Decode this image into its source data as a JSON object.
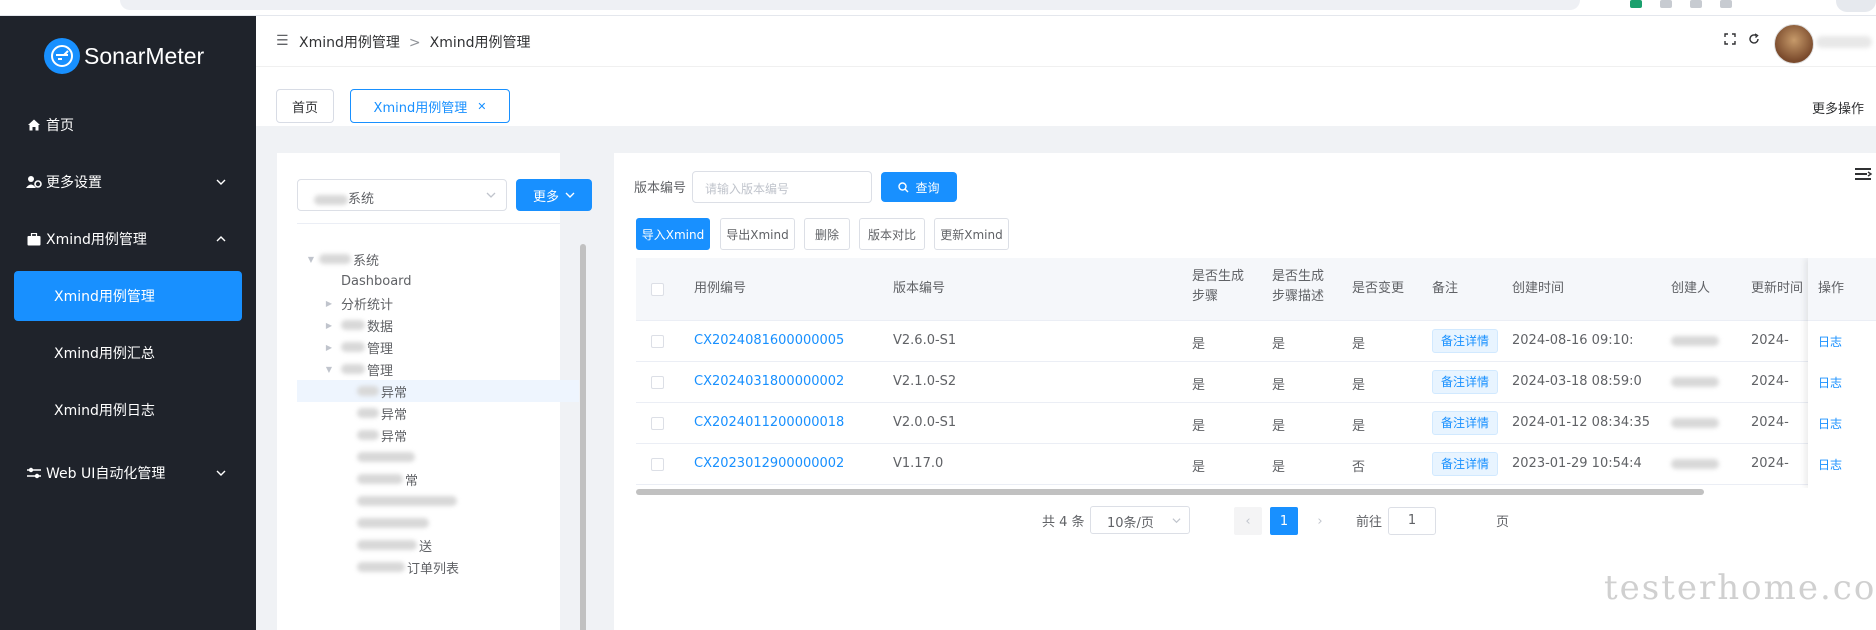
{
  "app": {
    "name": "SonarMeter"
  },
  "sidebar": {
    "items": [
      {
        "label": "首页",
        "icon": "home-icon"
      },
      {
        "label": "更多设置",
        "icon": "users-cog-icon"
      },
      {
        "label": "Xmind用例管理",
        "icon": "briefcase-icon"
      },
      {
        "label": "Web UI自动化管理",
        "icon": "sliders-icon"
      }
    ],
    "sub_items": [
      {
        "label": "Xmind用例管理",
        "active": true
      },
      {
        "label": "Xmind用例汇总"
      },
      {
        "label": "Xmind用例日志"
      }
    ]
  },
  "header": {
    "breadcrumb": [
      "Xmind用例管理",
      "Xmind用例管理"
    ]
  },
  "tags": [
    {
      "label": "首页"
    },
    {
      "label": "Xmind用例管理",
      "closable": true
    }
  ],
  "more_ops": "更多操作",
  "left": {
    "select_value": "系统",
    "more_btn": "更多",
    "tree": [
      {
        "label": "系统",
        "level": 0,
        "toggle": "▼"
      },
      {
        "label": "Dashboard",
        "level": 1
      },
      {
        "label": "分析统计",
        "level": 1,
        "toggle": "▶"
      },
      {
        "label": "数据",
        "level": 1,
        "toggle": "▶"
      },
      {
        "label": "管理",
        "level": 1,
        "toggle": "▶"
      },
      {
        "label": "管理",
        "level": 1,
        "toggle": "▼"
      },
      {
        "label": "异常",
        "level": 2,
        "selected": true
      },
      {
        "label": "异常",
        "level": 2
      },
      {
        "label": "异常",
        "level": 2
      },
      {
        "label": "",
        "level": 2
      },
      {
        "label": "常",
        "level": 2
      },
      {
        "label": "",
        "level": 2
      },
      {
        "label": "",
        "level": 2
      },
      {
        "label": "送",
        "level": 2
      },
      {
        "label": "订单列表",
        "level": 2
      }
    ]
  },
  "filter": {
    "label": "版本编号",
    "placeholder": "请输入版本编号",
    "query_btn": "查询"
  },
  "toolbar": {
    "import": "导入Xmind",
    "export": "导出Xmind",
    "delete": "删除",
    "compare": "版本对比",
    "update": "更新Xmind"
  },
  "table": {
    "columns": {
      "case_no": "用例编号",
      "version": "版本编号",
      "gen_steps": "是否生成步骤",
      "gen_desc": "是否生成步骤描述",
      "changed": "是否变更",
      "note": "备注",
      "created_at": "创建时间",
      "creator": "创建人",
      "updated": "更新时间",
      "ops": "操作"
    },
    "rows": [
      {
        "case_no": "CX2024081600000005",
        "version": "V2.6.0-S1",
        "gen_steps": "是",
        "gen_desc": "是",
        "changed": "是",
        "note": "备注详情",
        "created_at": "2024-08-16 09:10:",
        "updated": "2024-",
        "op": "日志"
      },
      {
        "case_no": "CX2024031800000002",
        "version": "V2.1.0-S2",
        "gen_steps": "是",
        "gen_desc": "是",
        "changed": "是",
        "note": "备注详情",
        "created_at": "2024-03-18 08:59:0",
        "updated": "2024-",
        "op": "日志"
      },
      {
        "case_no": "CX2024011200000018",
        "version": "V2.0.0-S1",
        "gen_steps": "是",
        "gen_desc": "是",
        "changed": "是",
        "note": "备注详情",
        "created_at": "2024-01-12 08:34:35",
        "updated": "2024-",
        "op": "日志"
      },
      {
        "case_no": "CX2023012900000002",
        "version": "V1.17.0",
        "gen_steps": "是",
        "gen_desc": "是",
        "changed": "否",
        "note": "备注详情",
        "created_at": "2023-01-29 10:54:4",
        "updated": "2024-",
        "op": "日志"
      }
    ]
  },
  "pagination": {
    "total": "共 4 条",
    "page_size": "10条/页",
    "current": "1",
    "goto_label": "前往",
    "goto_value": "1",
    "page_suffix": "页"
  },
  "watermark": "testerhome.com",
  "colors": {
    "primary": "#1890ff",
    "sidebar_bg": "#1f232b"
  }
}
